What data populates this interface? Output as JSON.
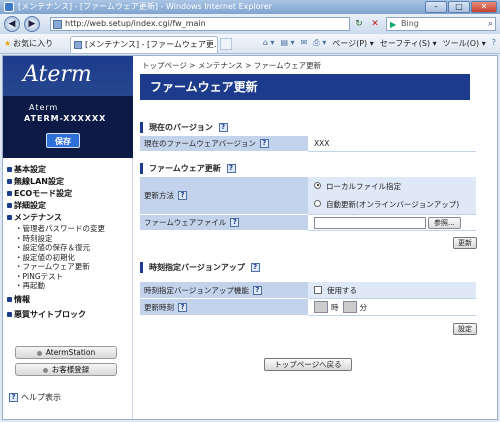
{
  "window": {
    "title": "[メンテナンス] - [ファームウェア更新] - Windows Internet Explorer",
    "minimize": "–",
    "maximize": "□",
    "close": "✕"
  },
  "address": {
    "url": "http://web.setup/index.cgi/fw_main",
    "search_placeholder": "Bing"
  },
  "toolbar": {
    "favorites": "お気に入り",
    "tab_title": "[メンテナンス] - [ファームウェア更...",
    "page_menu": "ページ(P) ▾",
    "safety_menu": "セーフティ(S) ▾",
    "tools_menu": "ツール(O) ▾",
    "help_icon": "?"
  },
  "sidebar": {
    "logo": "Aterm",
    "model_line1": "Aterm",
    "model_line2": "ATERM-XXXXXX",
    "save_label": "保存",
    "menu": [
      {
        "label": "基本設定"
      },
      {
        "label": "無線LAN設定"
      },
      {
        "label": "ECOモード設定"
      },
      {
        "label": "詳細設定"
      },
      {
        "label": "メンテナンス"
      }
    ],
    "maintenance_sub": [
      "・管理者パスワードの変更",
      "・時刻設定",
      "・設定値の保存＆復元",
      "・設定値の初期化",
      "・ファームウェア更新",
      "・PINGテスト",
      "・再起動"
    ],
    "menu_after": [
      {
        "label": "情報"
      },
      {
        "label": "悪質サイトブロック"
      }
    ],
    "aterm_station": "AtermStation",
    "register": "お客様登録",
    "help": "ヘルプ表示"
  },
  "main": {
    "breadcrumb": "トップページ > メンテナンス > ファームウェア更新",
    "title": "ファームウェア更新",
    "current_version": {
      "heading": "現在のバージョン",
      "label": "現在のファームウェアバージョン",
      "value": "XXX"
    },
    "update": {
      "heading": "ファームウェア更新",
      "method_label": "更新方法",
      "option_local": "ローカルファイル指定",
      "option_auto": "自動更新(オンラインバージョンアップ)",
      "file_label": "ファームウェアファイル",
      "browse": "参照...",
      "update_button": "更新"
    },
    "scheduled": {
      "heading": "時刻指定バージョンアップ",
      "feature_label": "時刻指定バージョンアップ機能",
      "use_label": "使用する",
      "time_label": "更新時刻",
      "hour_unit": "時",
      "minute_unit": "分",
      "set_button": "設定"
    },
    "back_to_top": "トップページへ戻る"
  }
}
